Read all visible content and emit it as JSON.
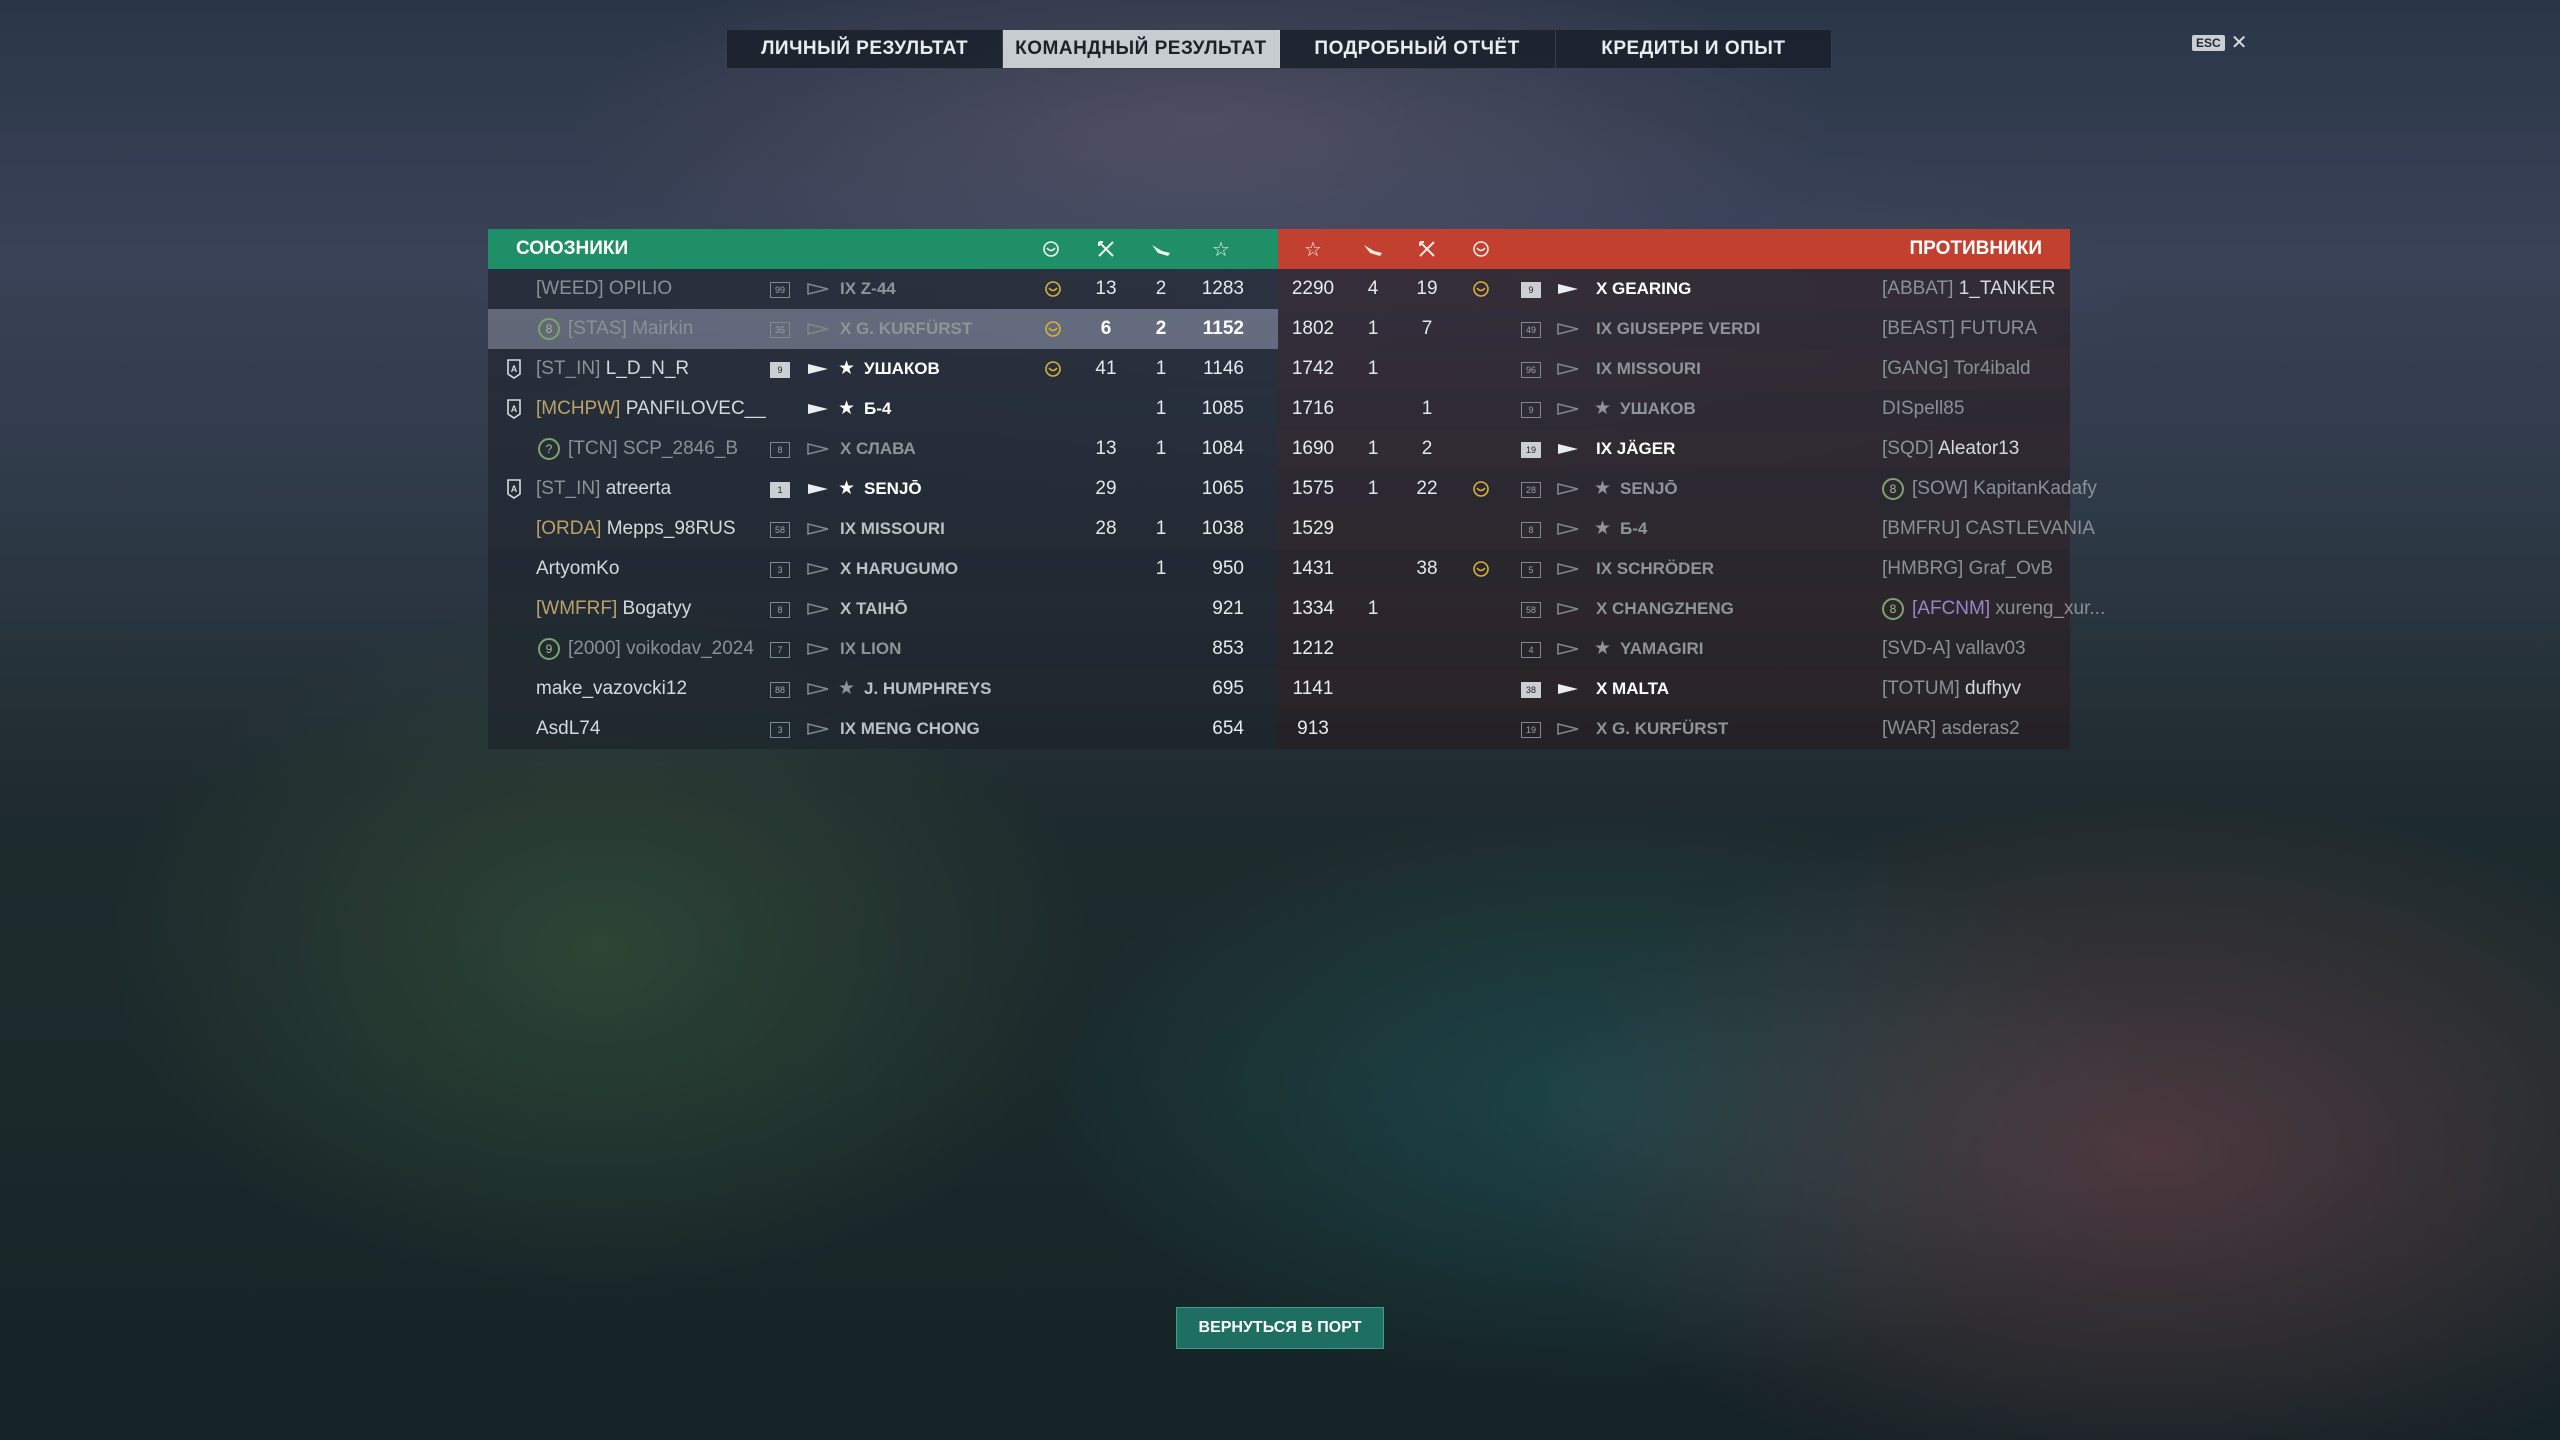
{
  "tabs": [
    {
      "label": "ЛИЧНЫЙ РЕЗУЛЬТАТ",
      "active": false
    },
    {
      "label": "КОМАНДНЫЙ РЕЗУЛЬТАТ",
      "active": true
    },
    {
      "label": "ПОДРОБНЫЙ ОТЧЁТ",
      "active": false
    },
    {
      "label": "КРЕДИТЫ И ОПЫТ",
      "active": false
    }
  ],
  "esc": {
    "key": "ESC",
    "close": "✕"
  },
  "allies": {
    "title": "СОЮЗНИКИ",
    "color": "#1f8f67",
    "rows": [
      {
        "clan": "[WEED]",
        "nick": "OPILIO",
        "lvl": "99",
        "ship": "IX Z-44",
        "medal": true,
        "kills": "13",
        "planes": "2",
        "score": "1283",
        "dim": true
      },
      {
        "clan": "[STAS]",
        "nick": "Mairkin",
        "lvl": "35",
        "ship": "X G. KURFÜRST",
        "medal": true,
        "kills": "6",
        "planes": "2",
        "score": "1152",
        "me": true,
        "badge": "8",
        "dim": true
      },
      {
        "clan": "[ST_IN]",
        "nick": "L_D_N_R",
        "lvl": "9",
        "ship": "УШАКОВ",
        "tier": "",
        "star": true,
        "medal": true,
        "kills": "41",
        "planes": "1",
        "score": "1146",
        "flag": true,
        "brightShip": true,
        "lvlHi": true
      },
      {
        "clan": "[MCHPW]",
        "nick": "PANFILOVEC__",
        "lvl": "",
        "ship": "Б-4",
        "star": true,
        "medal": false,
        "kills": "",
        "planes": "1",
        "score": "1085",
        "flag": true,
        "brightShip": true,
        "clanGold": true
      },
      {
        "clan": "[TCN]",
        "nick": "SCP_2846_B",
        "lvl": "8",
        "ship": "X СЛАВА",
        "medal": false,
        "kills": "13",
        "planes": "1",
        "score": "1084",
        "badge": "?",
        "dim": true
      },
      {
        "clan": "[ST_IN]",
        "nick": "atreerta",
        "lvl": "1",
        "ship": "SENJŌ",
        "star": true,
        "medal": false,
        "kills": "29",
        "planes": "",
        "score": "1065",
        "flag": true,
        "brightShip": true,
        "lvlHi": true
      },
      {
        "clan": "[ORDA]",
        "nick": "Mepps_98RUS",
        "lvl": "58",
        "ship": "IX MISSOURI",
        "medal": false,
        "kills": "28",
        "planes": "1",
        "score": "1038",
        "clanGold": true
      },
      {
        "clan": "",
        "nick": "ArtyomKo",
        "lvl": "3",
        "ship": "X HARUGUMO",
        "medal": false,
        "kills": "",
        "planes": "1",
        "score": "950"
      },
      {
        "clan": "[WMFRF]",
        "nick": "Bogatyy",
        "lvl": "8",
        "ship": "X TAIHŌ",
        "medal": false,
        "kills": "",
        "planes": "",
        "score": "921",
        "clanGold": true
      },
      {
        "clan": "[2000]",
        "nick": "voikodav_2024",
        "lvl": "7",
        "ship": "IX LION",
        "medal": false,
        "kills": "",
        "planes": "",
        "score": "853",
        "badge": "9",
        "dim": true
      },
      {
        "clan": "",
        "nick": "make_vazovcki12",
        "lvl": "88",
        "ship": "J. HUMPHREYS",
        "star": true,
        "medal": false,
        "kills": "",
        "planes": "",
        "score": "695"
      },
      {
        "clan": "",
        "nick": "AsdL74",
        "lvl": "3",
        "ship": "IX MENG CHONG",
        "medal": false,
        "kills": "",
        "planes": "",
        "score": "654"
      }
    ]
  },
  "enemies": {
    "title": "ПРОТИВНИКИ",
    "color": "#c2402f",
    "rows": [
      {
        "score": "2290",
        "planes": "4",
        "kills": "19",
        "medal": true,
        "lvl": "9",
        "ship": "X GEARING",
        "clan": "[ABBAT]",
        "nick": "1_TANKER",
        "brightShip": true,
        "lvlHi": true
      },
      {
        "score": "1802",
        "planes": "1",
        "kills": "7",
        "medal": false,
        "lvl": "49",
        "ship": "IX GIUSEPPE VERDI",
        "clan": "[BEAST]",
        "nick": "FUTURA",
        "dim": true
      },
      {
        "score": "1742",
        "planes": "1",
        "kills": "",
        "medal": false,
        "lvl": "96",
        "ship": "IX MISSOURI",
        "clan": "[GANG]",
        "nick": "Tor4ibald",
        "dim": true
      },
      {
        "score": "1716",
        "planes": "",
        "kills": "1",
        "medal": false,
        "lvl": "9",
        "ship": "УШАКОВ",
        "star": true,
        "clan": "",
        "nick": "DISpell85",
        "dim": true
      },
      {
        "score": "1690",
        "planes": "1",
        "kills": "2",
        "medal": false,
        "lvl": "19",
        "ship": "IX JÄGER",
        "clan": "[SQD]",
        "nick": "Aleator13",
        "brightShip": true,
        "lvlHi": true
      },
      {
        "score": "1575",
        "planes": "1",
        "kills": "22",
        "medal": true,
        "lvl": "28",
        "ship": "SENJŌ",
        "star": true,
        "clan": "[SOW]",
        "nick": "KapitanKadafy",
        "badge": "8",
        "dim": true
      },
      {
        "score": "1529",
        "planes": "",
        "kills": "",
        "medal": false,
        "lvl": "8",
        "ship": "Б-4",
        "star": true,
        "clan": "[BMFRU]",
        "nick": "CASTLEVANIA",
        "dim": true
      },
      {
        "score": "1431",
        "planes": "",
        "kills": "38",
        "medal": true,
        "lvl": "5",
        "ship": "IX SCHRÖDER",
        "clan": "[HMBRG]",
        "nick": "Graf_OvB",
        "dim": true
      },
      {
        "score": "1334",
        "planes": "1",
        "kills": "",
        "medal": false,
        "lvl": "58",
        "ship": "X CHANGZHENG",
        "clan": "[AFCNM]",
        "nick": "xureng_xur...",
        "badge": "8",
        "dim": true,
        "clanPurple": true
      },
      {
        "score": "1212",
        "planes": "",
        "kills": "",
        "medal": false,
        "lvl": "4",
        "ship": "YAMAGIRI",
        "star": true,
        "clan": "[SVD-A]",
        "nick": "vallav03",
        "dim": true
      },
      {
        "score": "1141",
        "planes": "",
        "kills": "",
        "medal": false,
        "lvl": "38",
        "ship": "X MALTA",
        "clan": "[TOTUM]",
        "nick": "dufhyv",
        "brightShip": true,
        "lvlHi": true
      },
      {
        "score": "913",
        "planes": "",
        "kills": "",
        "medal": false,
        "lvl": "19",
        "ship": "X G. KURFÜRST",
        "clan": "[WAR]",
        "nick": "asderas2",
        "dim": true
      }
    ]
  },
  "header_icons": {
    "medal": "laurel-medal-icon",
    "kills": "crossed-swords-icon",
    "planes": "plane-icon",
    "score": "star-icon"
  },
  "port_button": "ВЕРНУТЬСЯ В ПОРТ"
}
